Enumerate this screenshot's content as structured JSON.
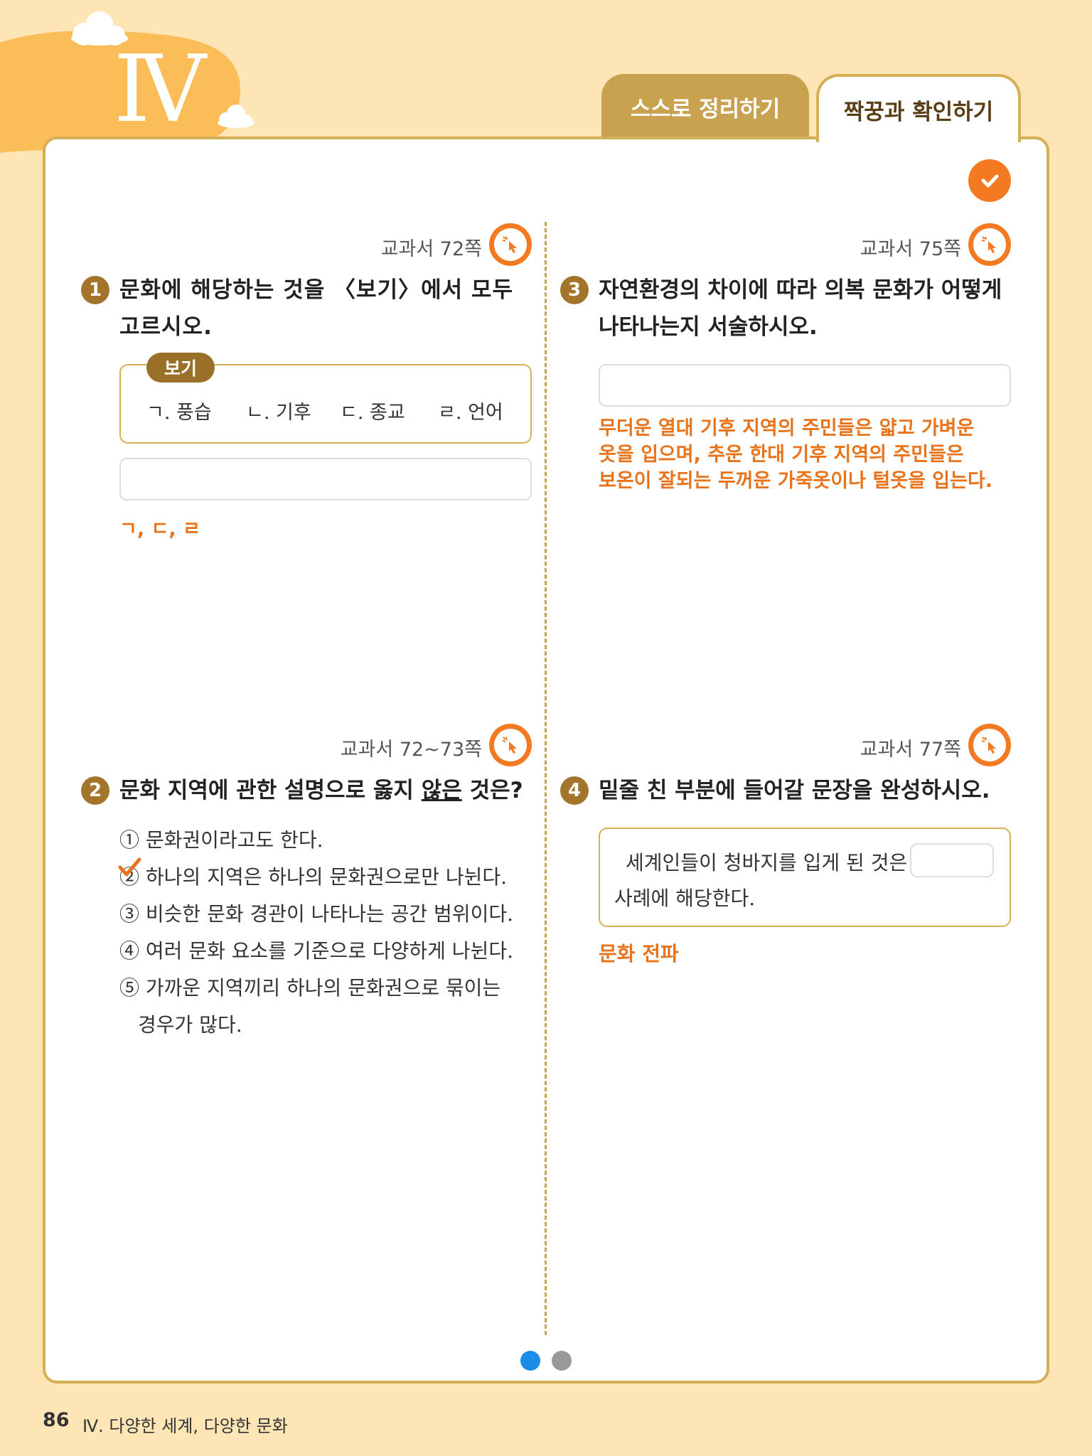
{
  "unit": {
    "numeral": "Ⅳ"
  },
  "tabs": {
    "self": "스스로 정리하기",
    "partner": "짝꿍과 확인하기"
  },
  "q1": {
    "ref": "교과서 72쪽",
    "num": "1",
    "text_line1": "문화에 해당하는 것을 〈보기〉에서 모두",
    "text_line2": "고르시오.",
    "example_tag": "보기",
    "examples": [
      "ㄱ. 풍습",
      "ㄴ. 기후",
      "ㄷ. 종교",
      "ㄹ. 언어"
    ],
    "answer": "ㄱ, ㄷ, ㄹ"
  },
  "q2": {
    "ref": "교과서 72~73쪽",
    "num": "2",
    "text_pre": "문화 지역에 관한 설명으로 옳지 ",
    "text_under": "않은",
    "text_post": " 것은?",
    "options": [
      "① 문화권이라고도 한다.",
      "② 하나의 지역은 하나의 문화권으로만 나뉜다.",
      "③ 비슷한 문화 경관이 나타나는 공간 범위이다.",
      "④ 여러 문화 요소를 기준으로 다양하게 나뉜다.",
      "⑤ 가까운 지역끼리 하나의 문화권으로 묶이는",
      "경우가 많다."
    ]
  },
  "q3": {
    "ref": "교과서 75쪽",
    "num": "3",
    "text_line1": "자연환경의 차이에 따라 의복 문화가 어떻게",
    "text_line2": "나타나는지 서술하시오.",
    "answer_lines": [
      "무더운 열대 기후 지역의 주민들은 얇고 가벼운",
      "옷을 입으며, 추운 한대 기후 지역의 주민들은",
      "보온이 잘되는 두꺼운 가죽옷이나 털옷을 입는다."
    ]
  },
  "q4": {
    "ref": "교과서 77쪽",
    "num": "4",
    "text": "밑줄 친 부분에 들어갈 문장을 완성하시오.",
    "sentence_line1": "세계인들이 청바지를 입게 된 것은",
    "sentence_line2": "사례에 해당한다.",
    "answer": "문화 전파"
  },
  "footer": {
    "page": "86",
    "title": "Ⅳ. 다양한 세계, 다양한 문화"
  },
  "colors": {
    "accent": "#f47a22",
    "answer": "#e8731a",
    "gold": "#d6ae55",
    "background": "#fde5b6"
  }
}
